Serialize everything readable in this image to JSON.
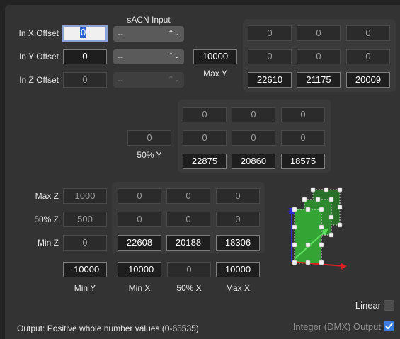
{
  "header": {
    "sacn_input": "sACN Input"
  },
  "offsets": {
    "x": {
      "label": "In X Offset",
      "value": "0",
      "select": "--"
    },
    "y": {
      "label": "In Y Offset",
      "value": "0",
      "select": "--"
    },
    "z": {
      "label": "In Z Offset",
      "value": "0",
      "select": "--"
    }
  },
  "maxY": {
    "value": "10000",
    "label": "Max Y"
  },
  "midY": {
    "value": "0",
    "label": "50% Y"
  },
  "grid1": {
    "rows": [
      [
        "0",
        "0",
        "0"
      ],
      [
        "0",
        "0",
        "0"
      ],
      [
        "22610",
        "21175",
        "20009"
      ]
    ]
  },
  "grid2": {
    "rows": [
      [
        "0",
        "0",
        "0"
      ],
      [
        "0",
        "0",
        "0"
      ],
      [
        "22875",
        "20860",
        "18575"
      ]
    ]
  },
  "grid3": {
    "rows": [
      [
        "0",
        "0",
        "0"
      ],
      [
        "0",
        "0",
        "0"
      ],
      [
        "22608",
        "20188",
        "18306"
      ]
    ]
  },
  "zfields": {
    "max": {
      "label": "Max Z",
      "value": "1000"
    },
    "mid": {
      "label": "50% Z",
      "value": "500"
    },
    "min": {
      "label": "Min Z",
      "value": "0"
    }
  },
  "bottom": {
    "minY": {
      "value": "-10000",
      "label": "Min Y"
    },
    "minX": {
      "value": "-10000",
      "label": "Min X"
    },
    "midX": {
      "value": "0",
      "label": "50% X"
    },
    "maxX": {
      "value": "10000",
      "label": "Max X"
    }
  },
  "linear": {
    "label": "Linear",
    "checked": false
  },
  "output": {
    "text": "Output: Positive whole number values (0-65535)"
  },
  "integer": {
    "label": "Integer (DMX) Output",
    "checked": true
  },
  "colors": {
    "accent": "#3a7de0",
    "green": "#2e9b2e",
    "panel": "#333333"
  },
  "icons": {
    "cube": "cube-axes-icon",
    "chevron": "chevron-updown-icon",
    "check": "checkmark-icon"
  }
}
